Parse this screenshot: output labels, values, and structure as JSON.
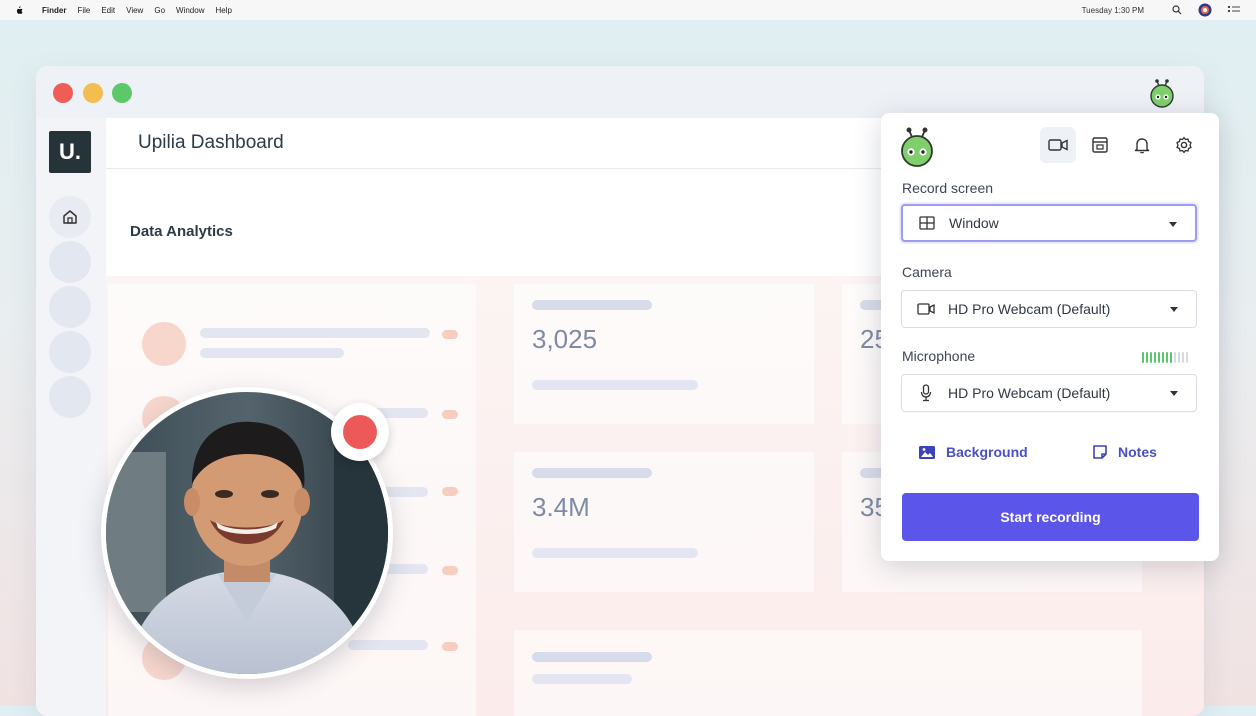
{
  "menubar": {
    "apple_icon": "apple-icon",
    "items": [
      "Finder",
      "File",
      "Edit",
      "View",
      "Go",
      "Window",
      "Help"
    ],
    "clock": "Tuesday 1:30 PM",
    "icons": [
      "search-icon",
      "user-globe-icon",
      "list-icon"
    ]
  },
  "app": {
    "logo": "U.",
    "title": "Upilia Dashboard",
    "section": "Data Analytics",
    "stats": [
      "3,025",
      "3.4M",
      "25",
      "35"
    ],
    "accent": "#ef6a3a"
  },
  "recorder": {
    "tools": [
      "camera-icon",
      "screen-icon",
      "bell-icon",
      "gear-icon"
    ],
    "record_screen_label": "Record screen",
    "record_screen_value": "Window",
    "camera_label": "Camera",
    "camera_value": "HD Pro Webcam (Default)",
    "microphone_label": "Microphone",
    "microphone_value": "HD Pro Webcam (Default)",
    "mic_level": 0.67,
    "background_label": "Background",
    "notes_label": "Notes",
    "start_label": "Start recording",
    "accent": "#5b55ea",
    "recording_dot_color": "#ed5858"
  }
}
